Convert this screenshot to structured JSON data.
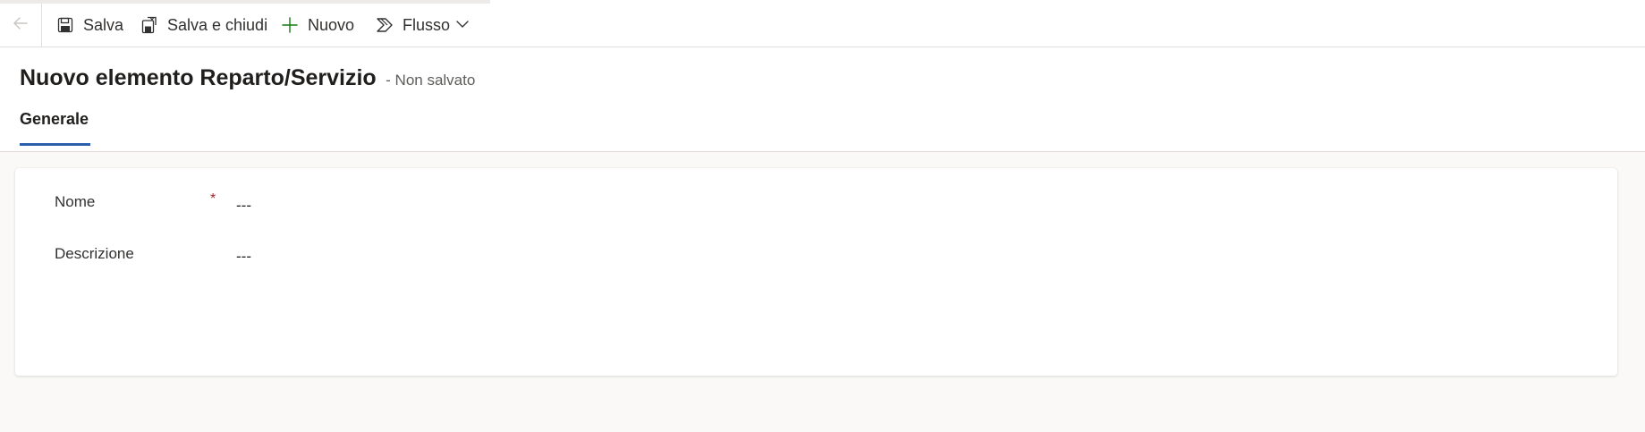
{
  "toolbar": {
    "back_icon": "arrow-left-icon",
    "save": {
      "label": "Salva",
      "icon": "save-icon"
    },
    "save_close": {
      "label": "Salva e chiudi",
      "icon": "save-close-icon"
    },
    "new": {
      "label": "Nuovo",
      "icon": "plus-icon"
    },
    "flow": {
      "label": "Flusso",
      "icon": "flow-icon"
    },
    "more_icon": "chevron-down-icon"
  },
  "header": {
    "title": "Nuovo elemento Reparto/Servizio",
    "status": "- Non salvato"
  },
  "tabs": [
    {
      "label": "Generale",
      "selected": true
    }
  ],
  "form": {
    "fields": [
      {
        "label": "Nome",
        "required_marker": "*",
        "value": "---"
      },
      {
        "label": "Descrizione",
        "value": "---"
      }
    ]
  },
  "colors": {
    "accent": "#2b5fab",
    "required": "#a4262c",
    "new_icon": "#107c10",
    "background": "#faf9f8"
  }
}
